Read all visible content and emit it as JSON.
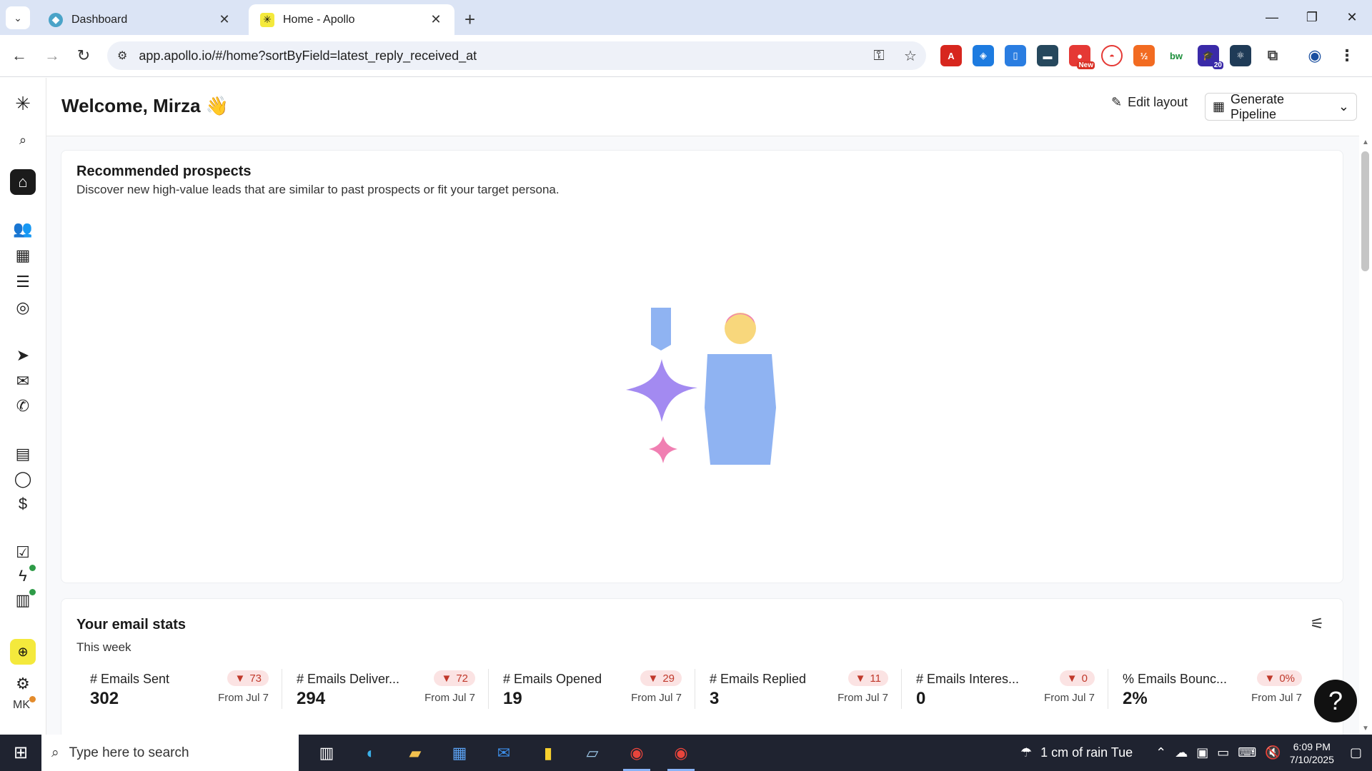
{
  "browser": {
    "tabs": [
      {
        "title": "Dashboard",
        "active": false
      },
      {
        "title": "Home - Apollo",
        "active": true
      }
    ],
    "url": "app.apollo.io/#/home?sortByField=latest_reply_received_at",
    "extensions": [
      {
        "name": "acrobat-icon",
        "color": "#d7261e"
      },
      {
        "name": "shield-extension-icon",
        "color": "#1d7be0"
      },
      {
        "name": "document-extension-icon",
        "color": "#2a7de1"
      },
      {
        "name": "clapper-extension-icon",
        "color": "#26485d"
      },
      {
        "name": "new-badge-extension-icon",
        "color": "#e53935",
        "badge": "New"
      },
      {
        "name": "pokeball-extension-icon",
        "color": "#e53935"
      },
      {
        "name": "code-extension-icon",
        "color": "#f26b21"
      },
      {
        "name": "bw-extension-icon",
        "color": "#1c8f3b",
        "text": "bw"
      },
      {
        "name": "graduation-extension-icon",
        "color": "#3a2aa8",
        "badge": "20"
      },
      {
        "name": "react-extension-icon",
        "color": "#1f3b57"
      },
      {
        "name": "puzzle-extension-icon",
        "color": "#555555"
      }
    ]
  },
  "header": {
    "welcome": "Welcome, Mirza 👋",
    "edit_layout": "Edit layout",
    "generate_pipeline": "Generate Pipeline"
  },
  "prospects": {
    "title": "Recommended prospects",
    "subtitle": "Discover new high-value leads that are similar to past prospects or fit your target persona."
  },
  "stats": {
    "title": "Your email stats",
    "period": "This week",
    "items": [
      {
        "label": "# Emails Sent",
        "value": "302",
        "delta": "73",
        "from": "From Jul 7"
      },
      {
        "label": "# Emails Deliver...",
        "value": "294",
        "delta": "72",
        "from": "From Jul 7"
      },
      {
        "label": "# Emails Opened",
        "value": "19",
        "delta": "29",
        "from": "From Jul 7"
      },
      {
        "label": "# Emails Replied",
        "value": "3",
        "delta": "11",
        "from": "From Jul 7"
      },
      {
        "label": "# Emails Interes...",
        "value": "0",
        "delta": "0",
        "from": "From Jul 7"
      },
      {
        "label": "% Emails Bounc...",
        "value": "2%",
        "delta": "0%",
        "from": "From Jul 7"
      }
    ]
  },
  "avatar": "MK",
  "help": "?",
  "taskbar": {
    "search_placeholder": "Type here to search",
    "weather": "1 cm of rain Tue",
    "time": "6:09 PM",
    "date": "7/10/2025"
  }
}
